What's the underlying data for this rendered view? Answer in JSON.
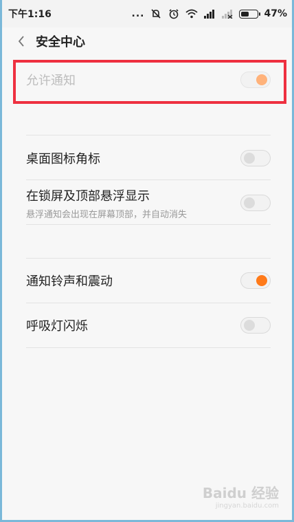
{
  "status_bar": {
    "time": "下午1:16",
    "dots": "...",
    "battery_pct": "47%",
    "battery_level": 0.47
  },
  "header": {
    "title": "安全中心"
  },
  "rows": [
    {
      "label": "允许通知",
      "enabled": true,
      "state": "on"
    },
    {
      "label": "桌面图标角标",
      "state": "off"
    },
    {
      "label": "在锁屏及顶部悬浮显示",
      "sub": "悬浮通知会出现在屏幕顶部，并自动消失",
      "state": "off"
    },
    {
      "label": "通知铃声和震动",
      "state": "on"
    },
    {
      "label": "呼吸灯闪烁",
      "state": "off"
    }
  ],
  "colors": {
    "accent": "#ff7a19",
    "highlight": "#ee3040"
  },
  "watermark": {
    "text": "Baidu 经验",
    "sub": "jingyan.baidu.com"
  }
}
